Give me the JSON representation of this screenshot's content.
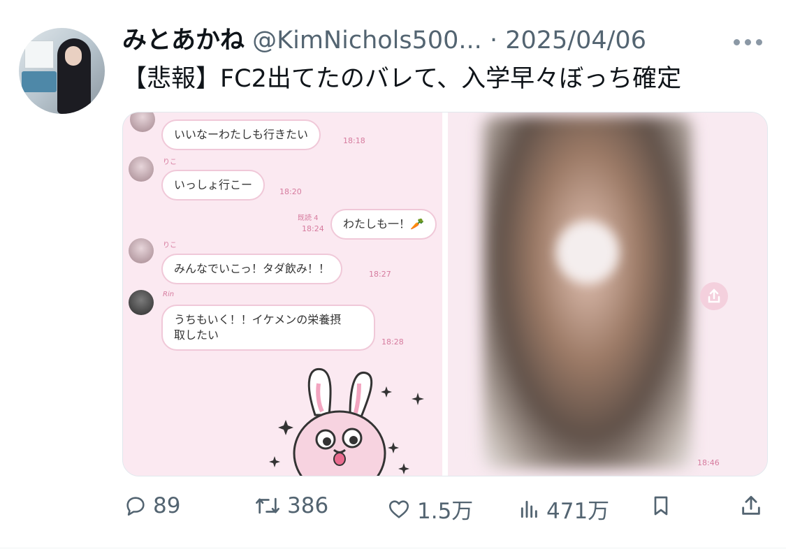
{
  "tweet": {
    "author_name": "みとあかね",
    "handle": "@KimNichols500...",
    "separator": "·",
    "date": "2025/04/06",
    "text": "【悲報】FC2出てたのバレて、入学早々ぼっち確定"
  },
  "chat": {
    "messages": [
      {
        "text": "いいなーわたしも行きたい",
        "time": "18:18"
      },
      {
        "sender": "りこ",
        "text": "いっしょ行こー",
        "time": "18:20"
      },
      {
        "read": "既読 4",
        "text": "わたしも一！🥕",
        "time": "18:24"
      },
      {
        "sender": "りこ",
        "text": "みんなでいこっ！タダ飲み！！",
        "time": "18:27"
      },
      {
        "sender": "Rin",
        "text_line1": "うちもいく！！イケメンの栄養摂",
        "text_line2": "取したい",
        "time": "18:28"
      }
    ],
    "photo_time": "18:46"
  },
  "actions": {
    "replies": "89",
    "retweets": "386",
    "likes": "1.5万",
    "views": "471万"
  },
  "icons": {
    "reply": "reply-icon",
    "retweet": "retweet-icon",
    "like": "heart-icon",
    "views": "views-icon",
    "bookmark": "bookmark-icon",
    "share": "share-icon",
    "more": "more-icon"
  },
  "colors": {
    "text_primary": "#0f1419",
    "text_secondary": "#536471",
    "chat_accent": "#d67b9e",
    "chat_background": "#fbe9f1"
  }
}
